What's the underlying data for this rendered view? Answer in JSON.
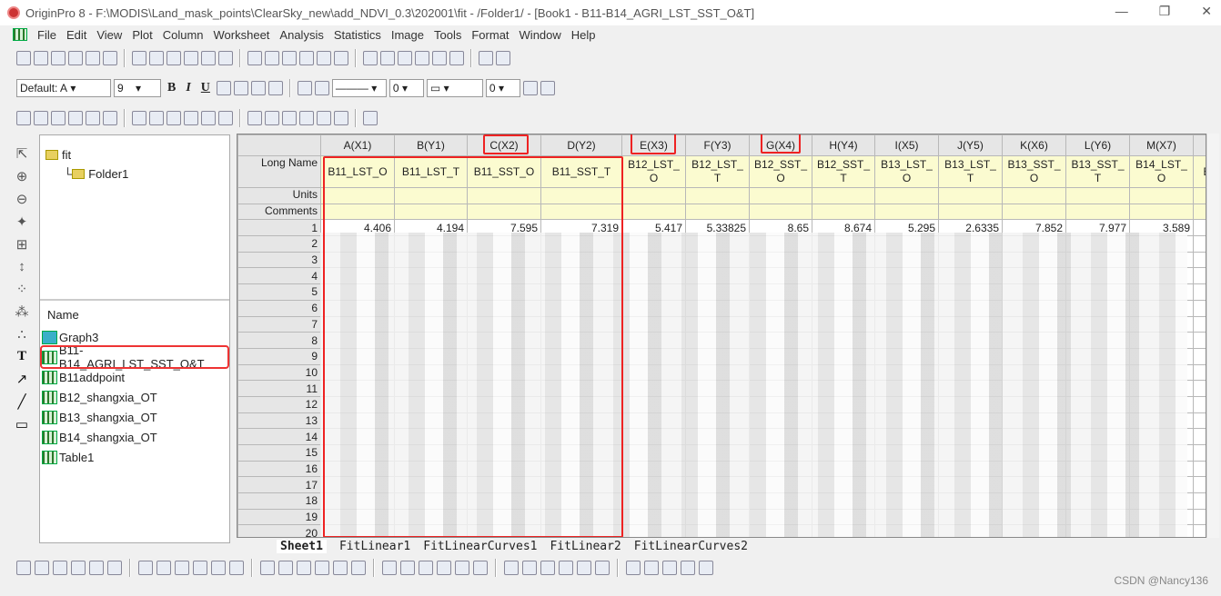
{
  "window": {
    "title": "OriginPro 8 - F:\\MODIS\\Land_mask_points\\ClearSky_new\\add_NDVI_0.3\\202001\\fit - /Folder1/ - [Book1 - B11-B14_AGRI_LST_SST_O&T]",
    "minimize": "—",
    "restore": "❐",
    "close": "✕"
  },
  "menu": [
    "File",
    "Edit",
    "View",
    "Plot",
    "Column",
    "Worksheet",
    "Analysis",
    "Statistics",
    "Image",
    "Tools",
    "Format",
    "Window",
    "Help"
  ],
  "format_toolbar": {
    "font": "Default: A",
    "size": "9",
    "bold": "B",
    "italic": "I",
    "underline": "U",
    "line_width": "0",
    "border_width": "0"
  },
  "project": {
    "tree": {
      "root": "fit",
      "child": "Folder1"
    },
    "list_header": "Name",
    "items": [
      {
        "name": "Graph3",
        "type": "graph"
      },
      {
        "name": "B11-B14_AGRI_LST_SST_O&T",
        "type": "workbook",
        "highlighted": true
      },
      {
        "name": "B11addpoint",
        "type": "workbook"
      },
      {
        "name": "B12_shangxia_OT",
        "type": "workbook"
      },
      {
        "name": "B13_shangxia_OT",
        "type": "workbook"
      },
      {
        "name": "B14_shangxia_OT",
        "type": "workbook"
      },
      {
        "name": "Table1",
        "type": "workbook"
      }
    ]
  },
  "worksheet": {
    "row_labels": {
      "long_name": "Long Name",
      "units": "Units",
      "comments": "Comments"
    },
    "columns": [
      {
        "header": "A(X1)",
        "long_name": "B11_LST_O",
        "r1": "4.406"
      },
      {
        "header": "B(Y1)",
        "long_name": "B11_LST_T",
        "r1": "4.194"
      },
      {
        "header": "C(X2)",
        "long_name": "B11_SST_O",
        "r1": "7.595"
      },
      {
        "header": "D(Y2)",
        "long_name": "B11_SST_T",
        "r1": "7.319"
      },
      {
        "header": "E(X3)",
        "long_name": "B12_LST_ O",
        "r1": "5.417"
      },
      {
        "header": "F(Y3)",
        "long_name": "B12_LST_ T",
        "r1": "5.33825"
      },
      {
        "header": "G(X4)",
        "long_name": "B12_SST_ O",
        "r1": "8.65"
      },
      {
        "header": "H(Y4)",
        "long_name": "B12_SST_ T",
        "r1": "8.674"
      },
      {
        "header": "I(X5)",
        "long_name": "B13_LST_ O",
        "r1": "5.295"
      },
      {
        "header": "J(Y5)",
        "long_name": "B13_LST_ T",
        "r1": "2.6335"
      },
      {
        "header": "K(X6)",
        "long_name": "B13_SST_ O",
        "r1": "7.852"
      },
      {
        "header": "L(Y6)",
        "long_name": "B13_SST_ T",
        "r1": "7.977"
      },
      {
        "header": "M(X7)",
        "long_name": "B14_LST_ O",
        "r1": "3.589"
      },
      {
        "header": "",
        "long_name": "E",
        "r1": ""
      }
    ],
    "rows": [
      "1",
      "2",
      "3",
      "4",
      "5",
      "6",
      "7",
      "8",
      "9",
      "10",
      "11",
      "12",
      "13",
      "14",
      "15",
      "16",
      "17",
      "18",
      "19",
      "20"
    ]
  },
  "sheet_tabs": [
    "Sheet1",
    "FitLinear1",
    "FitLinearCurves1",
    "FitLinear2",
    "FitLinearCurves2"
  ],
  "watermark": "CSDN @Nancy136",
  "colors": {
    "highlight": "#e22222",
    "meta_row": "#fbfbd0"
  }
}
